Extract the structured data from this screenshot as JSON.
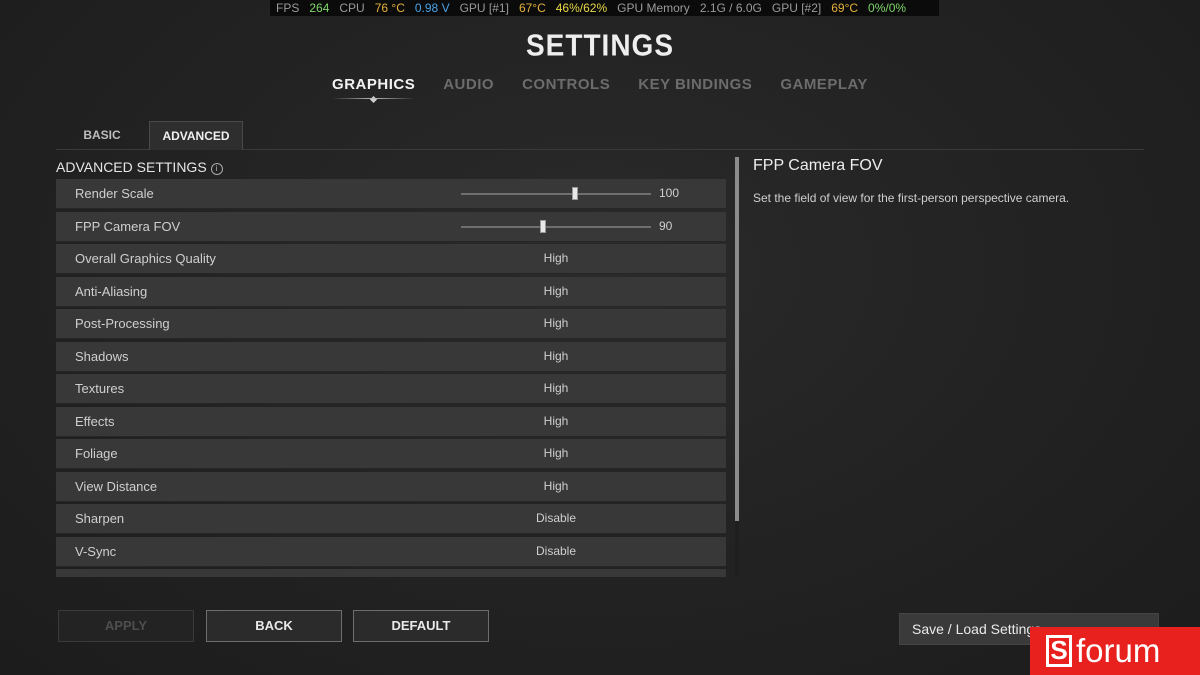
{
  "osd": {
    "fps_label": "FPS",
    "fps": "264",
    "cpu_label": "CPU",
    "cpu_temp": "76 °C",
    "cpu_volt": "0.98 V",
    "gpu1_label": "GPU [#1]",
    "gpu1_temp": "67°C",
    "gpu1_usage": "46%/62%",
    "gpumem_label": "GPU Memory",
    "gpumem": "2.1G / 6.0G",
    "gpu2_label": "GPU [#2]",
    "gpu2_temp": "69°C",
    "gpu2_usage": "0%/0%",
    "colors": {
      "green": "#7fd66b",
      "orange": "#e5b13b",
      "blue": "#4aa3e8"
    }
  },
  "header": {
    "title": "SETTINGS"
  },
  "main_tabs": [
    {
      "label": "GRAPHICS",
      "active": true
    },
    {
      "label": "AUDIO",
      "active": false
    },
    {
      "label": "CONTROLS",
      "active": false
    },
    {
      "label": "KEY BINDINGS",
      "active": false
    },
    {
      "label": "GAMEPLAY",
      "active": false
    }
  ],
  "sub_tabs": [
    {
      "label": "BASIC",
      "active": false
    },
    {
      "label": "ADVANCED",
      "active": true
    }
  ],
  "section": {
    "title": "ADVANCED SETTINGS",
    "info_icon": "info-icon"
  },
  "settings": {
    "render_scale": {
      "label": "Render Scale",
      "value": "100",
      "slider_fraction": 0.6
    },
    "fpp_fov": {
      "label": "FPP Camera FOV",
      "value": "90",
      "slider_fraction": 0.43
    },
    "rows": [
      {
        "label": "Overall Graphics Quality",
        "value": "High"
      },
      {
        "label": "Anti-Aliasing",
        "value": "High"
      },
      {
        "label": "Post-Processing",
        "value": "High"
      },
      {
        "label": "Shadows",
        "value": "High"
      },
      {
        "label": "Textures",
        "value": "High"
      },
      {
        "label": "Effects",
        "value": "High"
      },
      {
        "label": "Foliage",
        "value": "High"
      },
      {
        "label": "View Distance",
        "value": "High"
      },
      {
        "label": "Sharpen",
        "value": "Disable"
      },
      {
        "label": "V-Sync",
        "value": "Disable"
      },
      {
        "label": "",
        "value": ""
      }
    ]
  },
  "description": {
    "title": "FPP Camera FOV",
    "text": "Set the field of view for the first-person perspective camera."
  },
  "buttons": {
    "apply": "APPLY",
    "back": "BACK",
    "default": "DEFAULT"
  },
  "save_load": {
    "label": "Save / Load Settings"
  },
  "watermark": {
    "letter": "S",
    "text": "forum",
    "color": "#e8211f"
  }
}
